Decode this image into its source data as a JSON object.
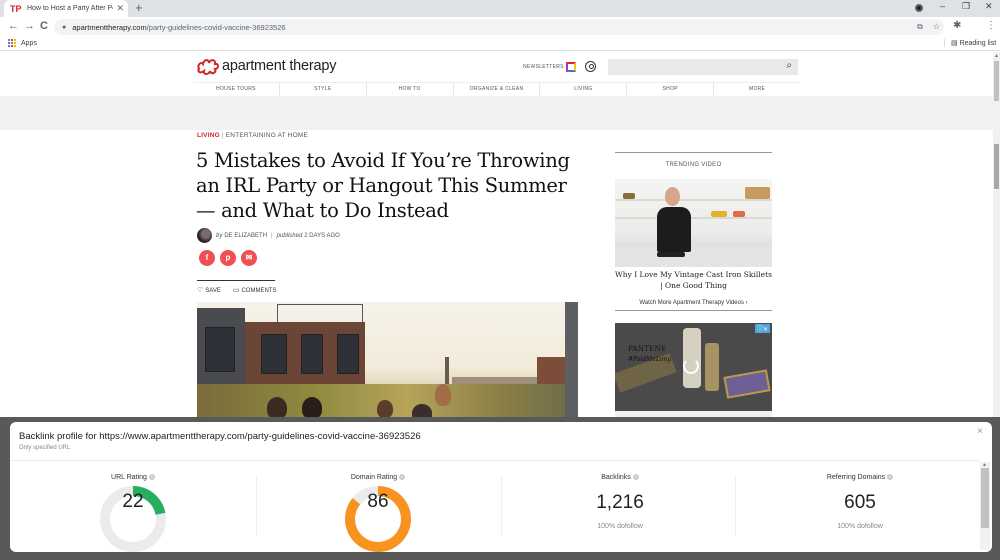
{
  "browser": {
    "tab_title": "How to Host a Party After People",
    "tab_favicon": "TP",
    "new_tab": "+",
    "url_host": "apartmenttherapy.com",
    "url_path": "/party-guidelines-covid-vaccine-36923526",
    "bookmarks_apps": "Apps",
    "reading_list": "Reading list",
    "icons": {
      "back": "←",
      "forward": "→",
      "reload": "C",
      "lock": "🔒",
      "install": "⧉",
      "star": "☆",
      "extensions": "✱",
      "menu": "⋮",
      "minimize": "–",
      "maximize": "❐",
      "close": "✕",
      "tab_close": "✕"
    }
  },
  "site": {
    "logo_text": "apartment therapy",
    "brand_color": "#d2232a",
    "newsletters": "NEWSLETTERS",
    "search_icon": "⌕",
    "nav": [
      "HOUSE TOURS",
      "STYLE",
      "HOW TO",
      "ORGANIZE & CLEAN",
      "LIVING",
      "SHOP",
      "MORE"
    ]
  },
  "article": {
    "category": "LIVING",
    "subcategory": "ENTERTAINING AT HOME",
    "headline": "5 Mistakes to Avoid If You’re Throwing an IRL Party or Hangout This Summer — and What to Do Instead",
    "by": "by",
    "author": "DE ELIZABETH",
    "published_label": "published",
    "published": "2 DAYS AGO",
    "share": {
      "facebook": "f",
      "pinterest": "p",
      "email": "✉"
    },
    "save": "SAVE",
    "comments": "COMMENTS",
    "save_icon": "♡",
    "comments_icon": "▭"
  },
  "sidebar": {
    "trending_label": "TRENDING VIDEO",
    "video_title": "Why I Love My Vintage Cast Iron Skillets | One Good Thing",
    "watch_more": "Watch More Apartment Therapy Videos ›",
    "ad_brand": "PANTENE",
    "ad_hashtag": "#PaidMeLong",
    "ad_choices": "ⓘ✕"
  },
  "backlink_panel": {
    "title": "Backlink profile for https://www.apartmenttherapy.com/party-guidelines-covid-vaccine-36923526",
    "subtitle": "Only specified URL",
    "close": "×",
    "metrics": [
      {
        "label": "URL Rating",
        "value": "22",
        "gauge_fraction": 0.22,
        "gauge_color": "#27ae60"
      },
      {
        "label": "Domain Rating",
        "value": "86",
        "gauge_fraction": 0.86,
        "gauge_color": "#f7931e"
      },
      {
        "label": "Backlinks",
        "value": "1,216",
        "note": "100% dofollow"
      },
      {
        "label": "Referring Domains",
        "value": "605",
        "note": "100% dofollow"
      }
    ],
    "info_icon": "i"
  }
}
